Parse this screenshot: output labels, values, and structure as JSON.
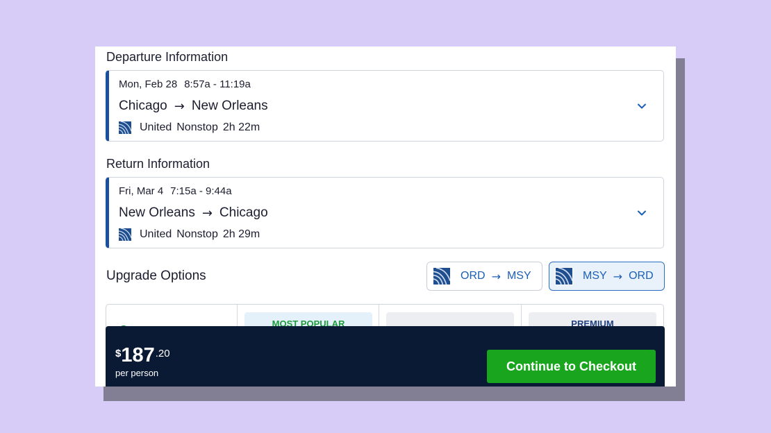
{
  "departure": {
    "section_title": "Departure Information",
    "date": "Mon, Feb 28",
    "time": "8:57a - 11:19a",
    "origin": "Chicago",
    "destination": "New Orleans",
    "airline": "United",
    "stops": "Nonstop",
    "duration": "2h 22m"
  },
  "return": {
    "section_title": "Return Information",
    "date": "Fri, Mar 4",
    "time": "7:15a - 9:44a",
    "origin": "New Orleans",
    "destination": "Chicago",
    "airline": "United",
    "stops": "Nonstop",
    "duration": "2h 29m"
  },
  "upgrade": {
    "title": "Upgrade Options",
    "segments": [
      {
        "from": "ORD",
        "to": "MSY",
        "active": false
      },
      {
        "from": "MSY",
        "to": "ORD",
        "active": true
      }
    ],
    "plans": [
      {
        "tag": ""
      },
      {
        "tag": "MOST POPULAR"
      },
      {
        "tag": ""
      },
      {
        "tag": "PREMIUM"
      }
    ]
  },
  "footer": {
    "currency": "$",
    "price_whole": "187",
    "price_cents": ".20",
    "per_person": "per person",
    "checkout_label": "Continue to Checkout"
  },
  "icons": {
    "airline_logo": "united-logo-icon",
    "route_arrow": "arrow-right-icon",
    "expand": "chevron-down-icon"
  },
  "colors": {
    "background": "#d7cbf7",
    "accent_blue": "#1b4fa0",
    "link_blue": "#1b5fb5",
    "popular_green": "#1d9a3a",
    "checkout_green": "#19a51d",
    "footer_navy": "#0b1a34"
  }
}
